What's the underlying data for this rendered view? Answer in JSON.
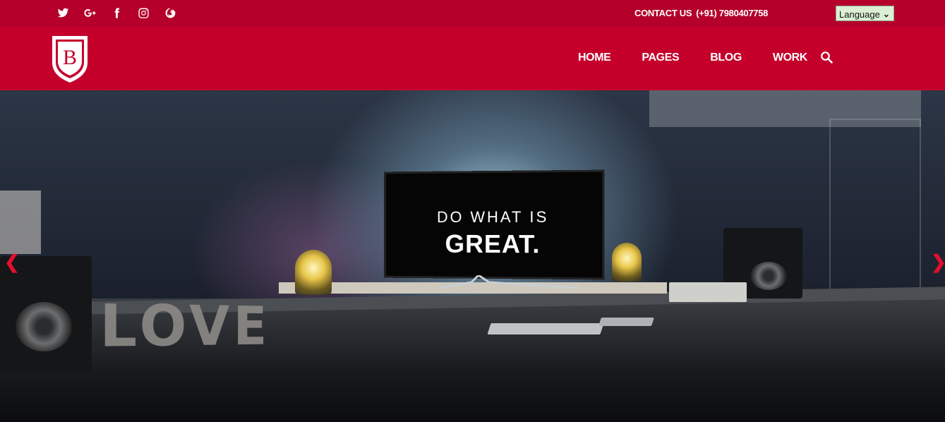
{
  "social": [
    {
      "name": "twitter-icon"
    },
    {
      "name": "google-plus-icon"
    },
    {
      "name": "facebook-icon"
    },
    {
      "name": "instagram-icon"
    },
    {
      "name": "firefox-icon"
    }
  ],
  "contact": {
    "label": "CONTACT US",
    "phone": "(+91) 7980407758"
  },
  "language": {
    "selected": "Language"
  },
  "brand": {
    "logo_letter": "B"
  },
  "nav": {
    "items": [
      "HOME",
      "PAGES",
      "BLOG",
      "WORK"
    ]
  },
  "hero": {
    "screen_line1": "DO WHAT IS",
    "screen_line2": "GREAT.",
    "desk_letters": "LOVE",
    "prev_arrow": "❮",
    "next_arrow": "❯"
  },
  "colors": {
    "topbar": "#b4002a",
    "navbar": "#c5002b",
    "arrows": "#e0102d"
  }
}
